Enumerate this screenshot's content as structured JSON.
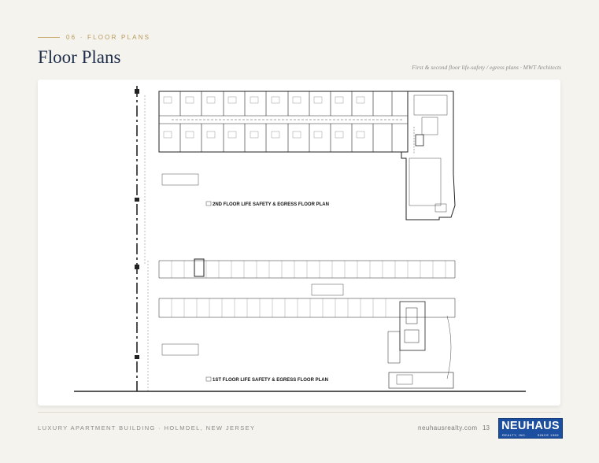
{
  "header": {
    "section_number_label": "06 · FLOOR PLANS",
    "title": "Floor Plans",
    "subtitle": "First & second floor life-safety / egress plans · MWT Architects"
  },
  "plans": {
    "second_floor_label": "2ND FLOOR LIFE SAFETY & EGRESS FLOOR PLAN",
    "first_floor_label": "1ST FLOOR LIFE SAFETY & EGRESS FLOOR PLAN"
  },
  "footer": {
    "property": "LUXURY APARTMENT BUILDING · HOLMDEL, NEW JERSEY",
    "url": "neuhausrealty.com",
    "page_number": "13"
  },
  "logo": {
    "name": "NEUHAUS",
    "left_tag": "REALTY, INC.",
    "right_tag": "SINCE 1969"
  },
  "colors": {
    "navy": "#1e2d4a",
    "gold": "#b8985a",
    "brand_blue": "#1c4fa0"
  }
}
